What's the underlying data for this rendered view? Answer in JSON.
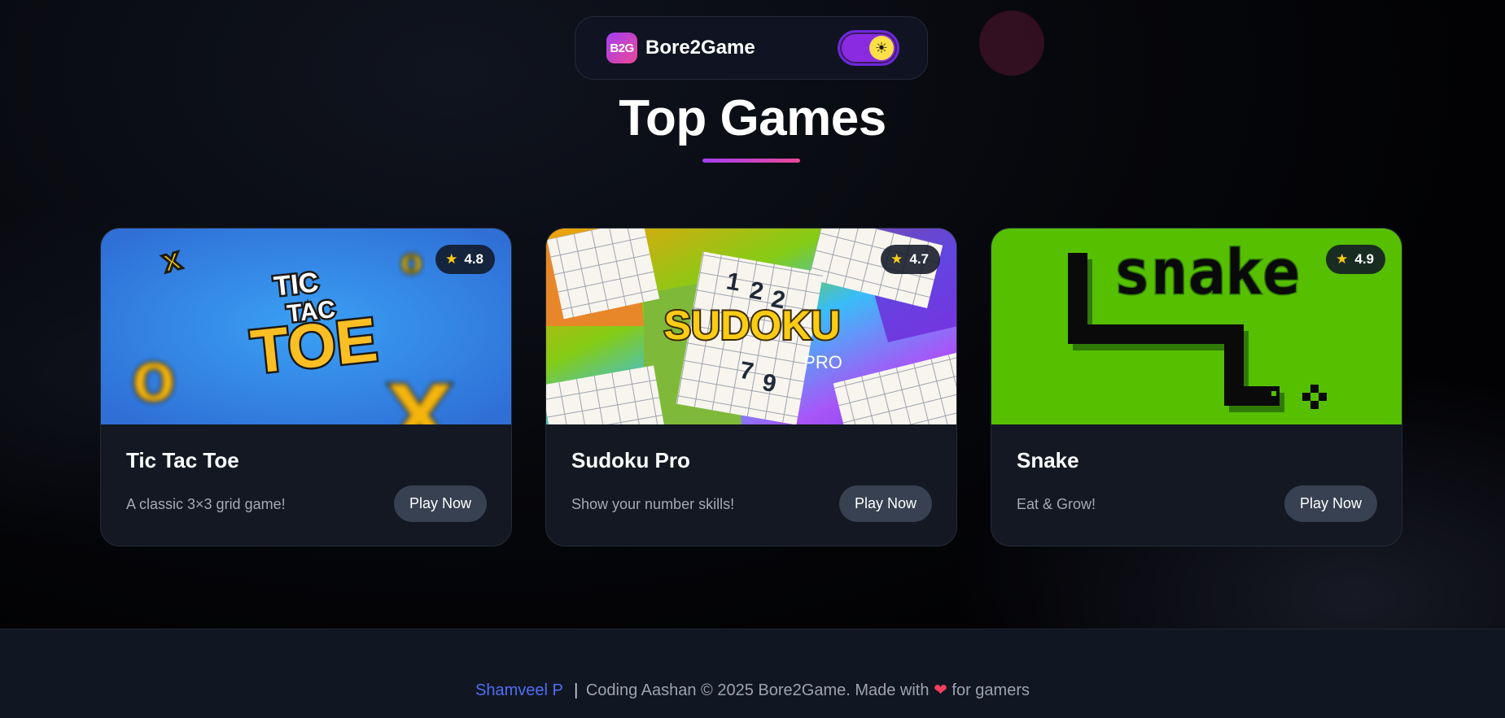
{
  "nav": {
    "logo_text": "B2G",
    "brand_name": "Bore2Game",
    "theme_icon": "sun-icon"
  },
  "page": {
    "title": "Top Games"
  },
  "games": [
    {
      "title": "Tic Tac Toe",
      "description": "A classic 3×3 grid game!",
      "rating": "4.8",
      "image_text": [
        "TIC",
        "TAC",
        "TOE"
      ],
      "button_label": "Play Now"
    },
    {
      "title": "Sudoku Pro",
      "description": "Show your number skills!",
      "rating": "4.7",
      "image_text": [
        "SUDOKU",
        "PRO"
      ],
      "button_label": "Play Now"
    },
    {
      "title": "Snake",
      "description": "Eat & Grow!",
      "rating": "4.9",
      "image_text": [
        "snake"
      ],
      "button_label": "Play Now"
    }
  ],
  "footer": {
    "author": "Shamveel P",
    "separator": "|",
    "text_before_heart": "Coding Aashan © 2025 Bore2Game. Made with",
    "heart": "❤",
    "text_after_heart": "for gamers"
  },
  "colors": {
    "accent_gradient_start": "#a23ef0",
    "accent_gradient_end": "#ec4899",
    "star": "#facc15",
    "author_link": "#4f6ef2"
  }
}
